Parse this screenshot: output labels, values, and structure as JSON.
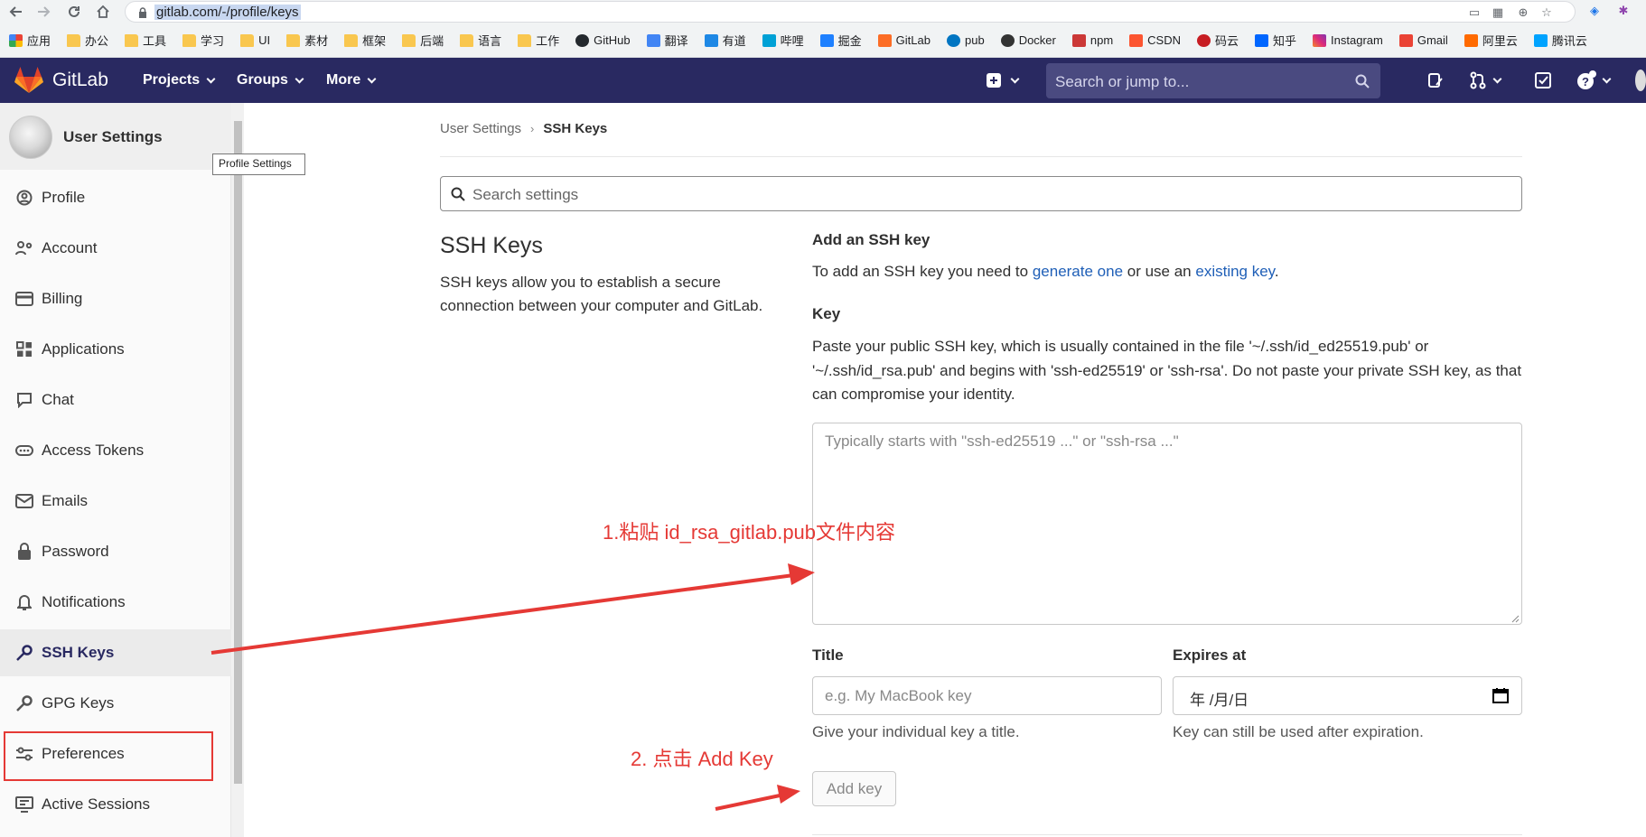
{
  "browser": {
    "url": "gitlab.com/-/profile/keys",
    "bookmarks": [
      "应用",
      "办公",
      "工具",
      "学习",
      "UI",
      "素材",
      "框架",
      "后端",
      "语言",
      "工作",
      "GitHub",
      "翻译",
      "有道",
      "哔哩",
      "掘金",
      "GitLab",
      "pub",
      "Docker",
      "npm",
      "CSDN",
      "码云",
      "知乎",
      "Instagram",
      "Gmail",
      "阿里云",
      "腾讯云"
    ]
  },
  "header": {
    "logo_text": "GitLab",
    "nav": {
      "projects": "Projects",
      "groups": "Groups",
      "more": "More"
    },
    "search_placeholder": "Search or jump to..."
  },
  "sidebar": {
    "title": "User Settings",
    "tooltip": "Profile Settings",
    "items": [
      {
        "label": "Profile",
        "icon": "profile-icon"
      },
      {
        "label": "Account",
        "icon": "account-icon"
      },
      {
        "label": "Billing",
        "icon": "credit-card-icon"
      },
      {
        "label": "Applications",
        "icon": "applications-icon"
      },
      {
        "label": "Chat",
        "icon": "comment-icon"
      },
      {
        "label": "Access Tokens",
        "icon": "token-icon"
      },
      {
        "label": "Emails",
        "icon": "mail-icon"
      },
      {
        "label": "Password",
        "icon": "lock-icon"
      },
      {
        "label": "Notifications",
        "icon": "notifications-icon"
      },
      {
        "label": "SSH Keys",
        "icon": "key-icon",
        "active": true
      },
      {
        "label": "GPG Keys",
        "icon": "key-icon"
      },
      {
        "label": "Preferences",
        "icon": "preferences-icon"
      },
      {
        "label": "Active Sessions",
        "icon": "monitor-icon"
      }
    ]
  },
  "breadcrumb": {
    "parent": "User Settings",
    "current": "SSH Keys"
  },
  "search_settings": {
    "placeholder": "Search settings"
  },
  "section": {
    "title": "SSH Keys",
    "description": "SSH keys allow you to establish a secure connection between your computer and GitLab."
  },
  "form": {
    "title": "Add an SSH key",
    "intro_prefix": "To add an SSH key you need to ",
    "intro_link1": "generate one",
    "intro_mid": " or use an ",
    "intro_link2": "existing key",
    "intro_suffix": ".",
    "key_label": "Key",
    "key_help": "Paste your public SSH key, which is usually contained in the file '~/.ssh/id_ed25519.pub' or '~/.ssh/id_rsa.pub' and begins with 'ssh-ed25519' or 'ssh-rsa'. Do not paste your private SSH key, as that can compromise your identity.",
    "key_placeholder": "Typically starts with \"ssh-ed25519 ...\" or \"ssh-rsa ...\"",
    "title_label": "Title",
    "title_placeholder": "e.g. My MacBook key",
    "title_help": "Give your individual key a title.",
    "expires_label": "Expires at",
    "expires_value": "年 /月/日",
    "expires_help": "Key can still be used after expiration.",
    "submit_label": "Add key"
  },
  "annotations": {
    "step1": "1.粘贴 id_rsa_gitlab.pub文件内容",
    "step2": "2. 点击 Add Key",
    "color": "#e53935"
  },
  "colors": {
    "header_bg": "#292961",
    "link": "#1f5fb7",
    "annotation": "#e53935"
  }
}
